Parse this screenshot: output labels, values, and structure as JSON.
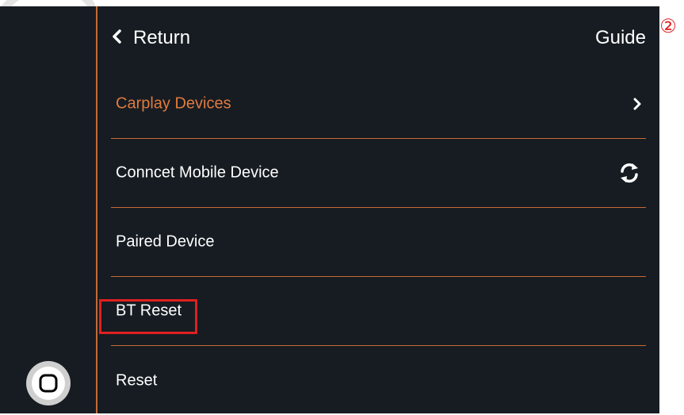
{
  "header": {
    "return_label": "Return",
    "guide_label": "Guide"
  },
  "menu": {
    "items": [
      {
        "label": "Carplay Devices",
        "active": true,
        "trailing": "chevron-right-icon"
      },
      {
        "label": "Conncet Mobile Device",
        "active": false,
        "trailing": "refresh-icon"
      },
      {
        "label": "Paired Device",
        "active": false,
        "trailing": ""
      },
      {
        "label": "BT Reset",
        "active": false,
        "trailing": ""
      },
      {
        "label": "Reset",
        "active": false,
        "trailing": ""
      }
    ]
  },
  "annotation": {
    "step_marker": "②",
    "highlighted_item": "BT Reset"
  },
  "colors": {
    "screen_bg": "#161c22",
    "accent": "#c46a36",
    "active_text": "#e07a3e",
    "highlight": "#e02020",
    "text": "#ffffff"
  }
}
